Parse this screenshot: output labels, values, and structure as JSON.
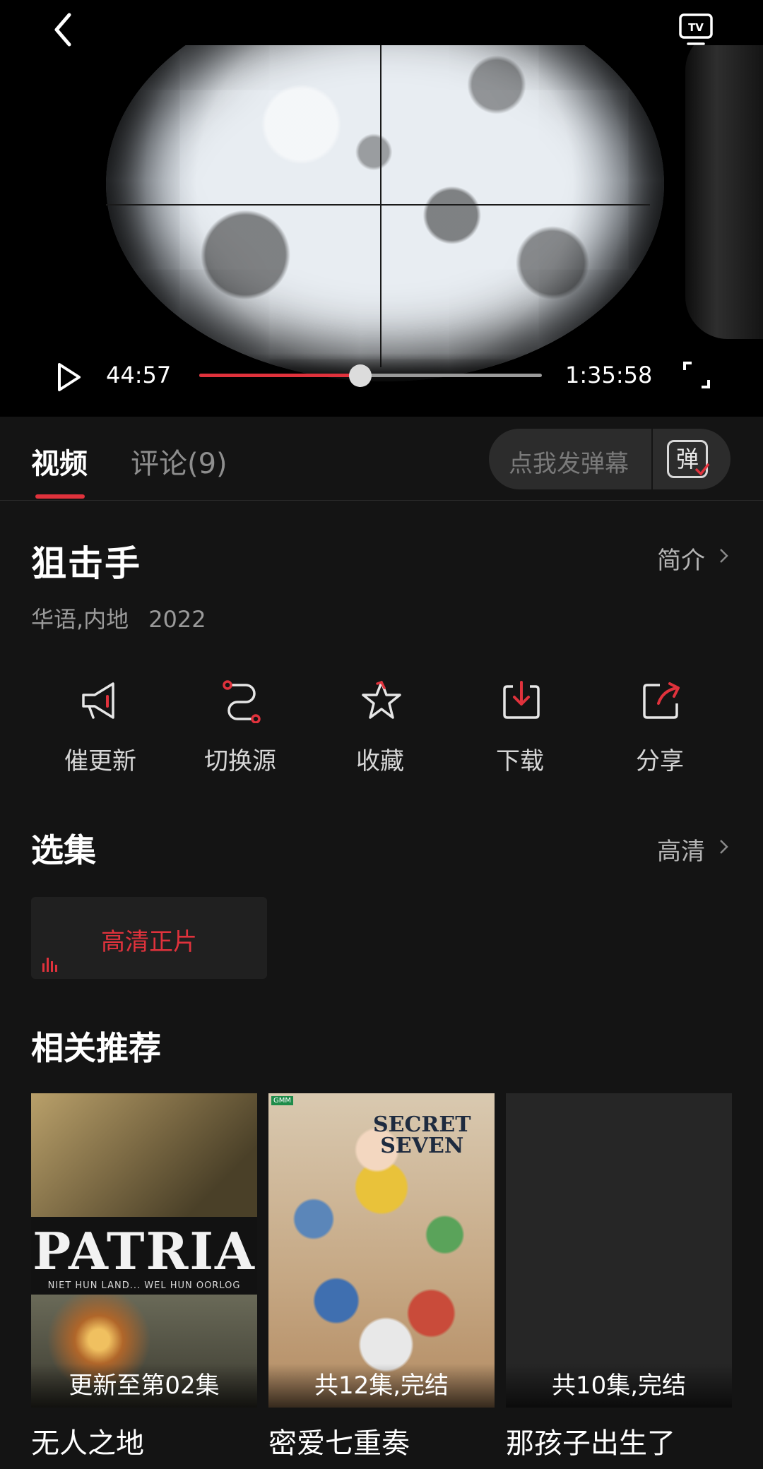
{
  "player": {
    "current_time": "44:57",
    "total_time": "1:35:58",
    "progress": 0.47
  },
  "tabs": {
    "video": "视频",
    "comments": "评论(9)"
  },
  "danmu": {
    "placeholder": "点我发弹幕",
    "button": "弹"
  },
  "info": {
    "title": "狙击手",
    "intro": "简介",
    "language_region": "华语,内地",
    "year": "2022"
  },
  "actions": [
    {
      "label": "催更新",
      "icon": "megaphone-icon"
    },
    {
      "label": "切换源",
      "icon": "switch-source-icon"
    },
    {
      "label": "收藏",
      "icon": "star-icon"
    },
    {
      "label": "下载",
      "icon": "download-icon"
    },
    {
      "label": "分享",
      "icon": "share-icon"
    }
  ],
  "episodes": {
    "title": "选集",
    "quality": "高清",
    "items": [
      {
        "label": "高清正片"
      }
    ]
  },
  "recommend": {
    "title": "相关推荐",
    "items": [
      {
        "title": "无人之地",
        "badge": "更新至第02集",
        "poster_text": "PATRIA",
        "poster_subtext": "NIET HUN LAND... WEL HUN OORLOG"
      },
      {
        "title": "密爱七重奏",
        "badge": "共12集,完结",
        "poster_text": "SECRET SEVEN"
      },
      {
        "title": "那孩子出生了",
        "badge": "共10集,完结"
      }
    ]
  },
  "colors": {
    "accent": "#e0323c",
    "background": "#141414"
  }
}
